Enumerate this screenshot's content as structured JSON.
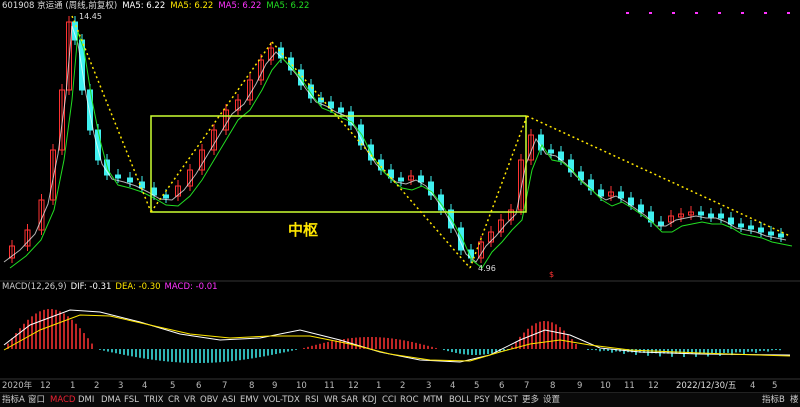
{
  "header": {
    "code_name": "601908 京运通 (周线,前复权)",
    "ma_items": [
      {
        "text": "MA5: 6.22",
        "color": "#ffffff"
      },
      {
        "text": "MA5: 6.22",
        "color": "#ffe600"
      },
      {
        "text": "MA5: 6.22",
        "color": "#ff33ff"
      },
      {
        "text": "MA5: 6.22",
        "color": "#22dd22"
      }
    ]
  },
  "annotations": {
    "high_label": "14.45",
    "low_label": "4.96",
    "zhongshu_label": "中枢"
  },
  "macd_header": {
    "title": "MACD(12,26,9)",
    "dif": "DIF: -0.31",
    "dea": "DEA: -0.30",
    "macd": "MACD: -0.01"
  },
  "x_axis": {
    "labels": [
      "2020年",
      "12",
      "1",
      "2",
      "3",
      "4",
      "5",
      "6",
      "7",
      "8",
      "9",
      "10",
      "11",
      "12",
      "1",
      "2",
      "3",
      "4",
      "5",
      "6",
      "7",
      "8",
      "9",
      "10",
      "11",
      "12",
      "2022/12/30/五",
      "4",
      "5"
    ]
  },
  "tabs": {
    "left_label": "指标A",
    "window_label": "窗口",
    "items": [
      "MACD",
      "DMI",
      "DMA",
      "FSL",
      "TRIX",
      "CR",
      "VR",
      "OBV",
      "ASI",
      "EMV",
      "VOL-TDX",
      "RSI",
      "WR",
      "SAR",
      "KDJ",
      "CCI",
      "ROC",
      "MTM",
      "BOLL",
      "PSY",
      "MCST",
      "更多",
      "设置"
    ],
    "active": "MACD",
    "right_label": "指标B",
    "right_extra": "楼"
  },
  "colors": {
    "up": "#ff3333",
    "down": "#3ff0f0",
    "ma_white": "#ffffff",
    "ma_yellow": "#ffe600",
    "ma_green": "#22dd22",
    "zhongshu": "#ccff33",
    "dotted": "#ffe600"
  }
}
